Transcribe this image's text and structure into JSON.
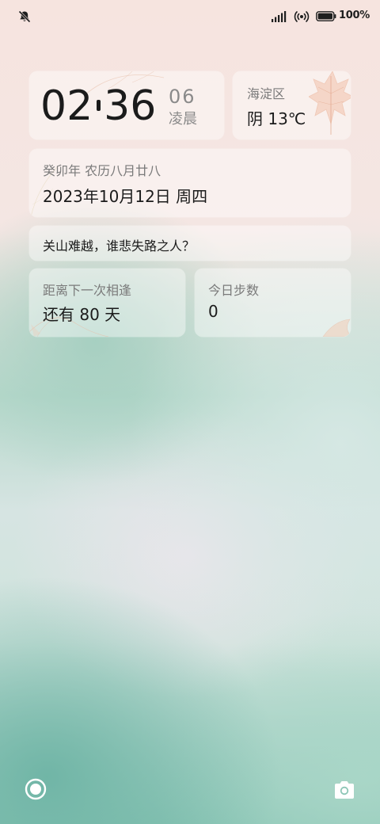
{
  "status_bar": {
    "mute_icon": "bell-off-icon",
    "signal_icon": "cellular-signal-icon",
    "hotspot_icon": "hotspot-icon",
    "battery_icon": "battery-icon",
    "battery_percent": "100%",
    "battery_level": 1.0
  },
  "clock": {
    "hours": "02",
    "minutes": "36",
    "seconds": "06",
    "period": "凌晨"
  },
  "weather": {
    "location": "海淀区",
    "condition": "阴  13℃",
    "leaf_icon": "maple-leaf-icon"
  },
  "calendar": {
    "lunar": "癸卯年 农历八月廿八",
    "solar": "2023年10月12日 周四"
  },
  "quote": {
    "text": "关山难越，谁悲失路之人？"
  },
  "countdown": {
    "title": "距离下一次相逢",
    "value": "还有 80 天"
  },
  "steps": {
    "title": "今日步数",
    "value": "0"
  },
  "shortcuts": {
    "left_icon": "assistant-ring-icon",
    "right_icon": "camera-icon"
  },
  "colors": {
    "text_primary": "#1b1b1b",
    "text_secondary": "#7a7a7a",
    "leaf_accent": "#e8a98a"
  }
}
